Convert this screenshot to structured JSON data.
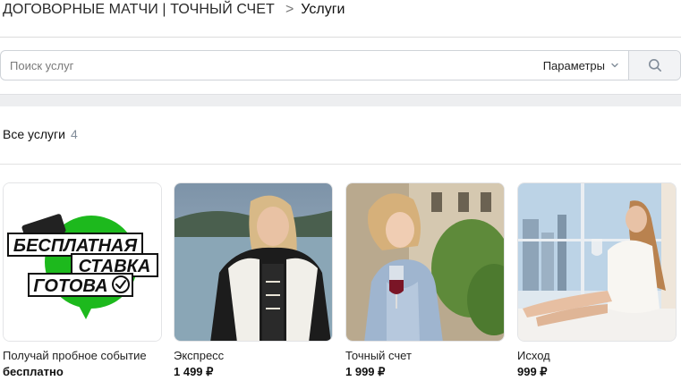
{
  "breadcrumb": {
    "group": "ДОГОВОРНЫЕ МАТЧИ | ТОЧНЫЙ СЧЕТ",
    "separator": ">",
    "current": "Услуги"
  },
  "search": {
    "placeholder": "Поиск услуг",
    "value": "",
    "params_label": "Параметры"
  },
  "section": {
    "title": "Все услуги",
    "count": "4"
  },
  "promo": {
    "line1": "БЕСПЛАТНАЯ",
    "line2": "СТАВКА",
    "line3": "ГОТОВА"
  },
  "products": [
    {
      "title": "Получай пробное событие",
      "price": "бесплатно"
    },
    {
      "title": "Экспресс",
      "price": "1 499 ₽"
    },
    {
      "title": "Точный счет",
      "price": "1 999 ₽"
    },
    {
      "title": "Исход",
      "price": "999 ₽"
    }
  ],
  "colors": {
    "accent_green": "#1db91d",
    "count_gray": "#818c99"
  }
}
